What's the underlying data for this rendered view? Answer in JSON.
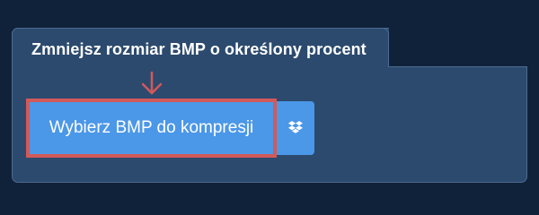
{
  "panel": {
    "title": "Zmniejsz rozmiar BMP o określony procent"
  },
  "upload": {
    "button_label": "Wybierz BMP do kompresji",
    "dropbox_icon": "dropbox-icon"
  },
  "colors": {
    "background": "#10223a",
    "panel": "#2c4a6e",
    "button": "#4b97e8",
    "highlight": "#d2595a"
  }
}
